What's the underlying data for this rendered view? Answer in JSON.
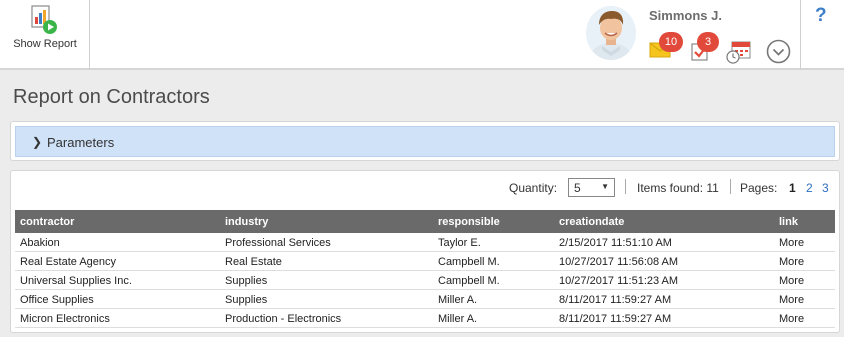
{
  "toolbar": {
    "show_report_label": "Show Report"
  },
  "user": {
    "name": "Simmons J.",
    "mail_count": "10",
    "task_count": "3"
  },
  "help_label": "?",
  "page_title": "Report on Contractors",
  "parameters": {
    "label": "Parameters"
  },
  "pager": {
    "quantity_label": "Quantity:",
    "quantity_value": "5",
    "items_found": "Items found: 11",
    "pages_label": "Pages:",
    "pages": [
      "1",
      "2",
      "3"
    ],
    "current_page": "1"
  },
  "table": {
    "columns": [
      "contractor",
      "industry",
      "responsible",
      "creationdate",
      "link"
    ],
    "rows": [
      [
        "Abakion",
        "Professional Services",
        "Taylor E.",
        "2/15/2017 11:51:10 AM",
        "More"
      ],
      [
        "Real Estate Agency",
        "Real Estate",
        "Campbell M.",
        "10/27/2017 11:56:08 AM",
        "More"
      ],
      [
        "Universal Supplies Inc.",
        "Supplies",
        "Campbell M.",
        "10/27/2017 11:51:23 AM",
        "More"
      ],
      [
        "Office Supplies",
        "Supplies",
        "Miller A.",
        "8/11/2017 11:59:27 AM",
        "More"
      ],
      [
        "Micron Electronics",
        "Production - Electronics",
        "Miller A.",
        "8/11/2017 11:59:27 AM",
        "More"
      ]
    ]
  },
  "colors": {
    "accent_blue": "#3c7fc8",
    "params_bar": "#cfe2f8",
    "badge_red": "#e14a3a",
    "header_gray": "#6a6a6a"
  },
  "icons": {
    "show_report": "report-play-icon",
    "mail": "envelope-icon",
    "tasks": "task-check-icon",
    "calendar": "calendar-clock-icon",
    "menu": "chevron-circle-icon"
  }
}
